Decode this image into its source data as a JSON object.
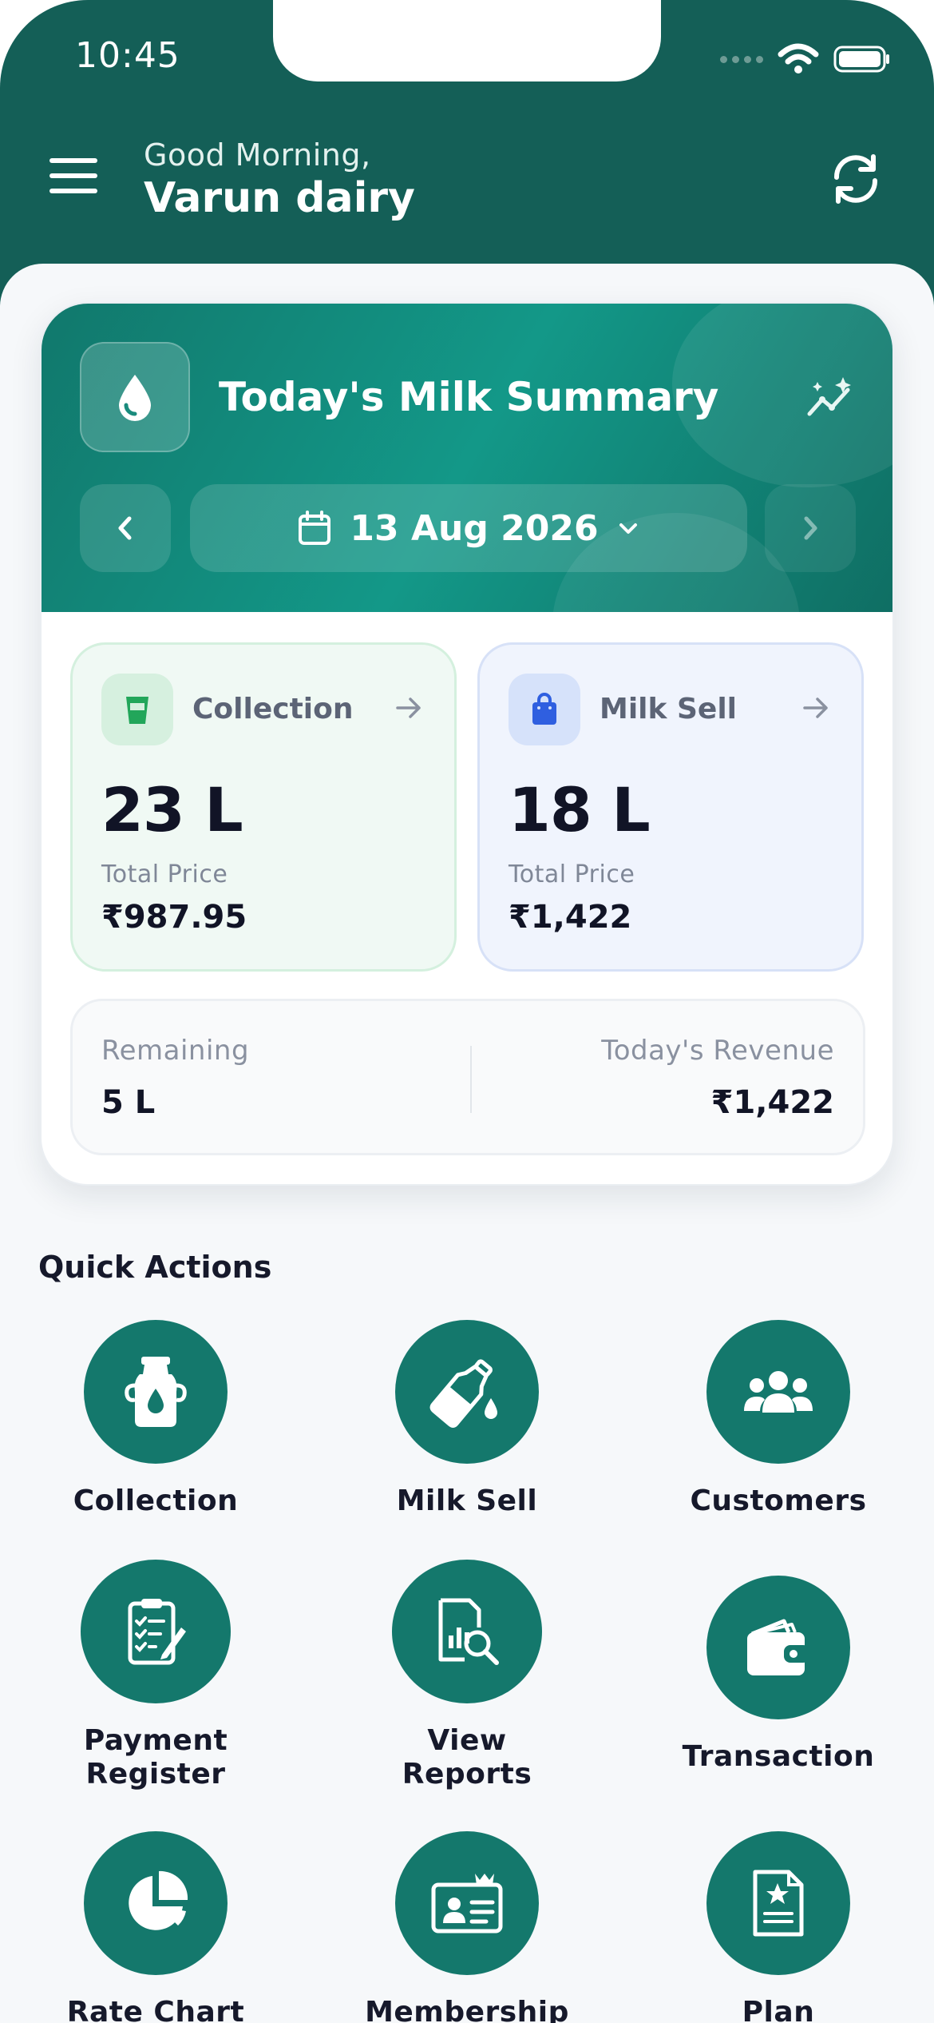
{
  "status_bar": {
    "time": "10:45"
  },
  "header": {
    "greeting": "Good Morning,",
    "business_name": "Varun dairy"
  },
  "summary": {
    "title": "Today's Milk Summary",
    "date": "13 Aug 2026",
    "collection": {
      "label": "Collection",
      "value": "23 L",
      "price_label": "Total Price",
      "price": "₹987.95"
    },
    "milk_sell": {
      "label": "Milk Sell",
      "value": "18 L",
      "price_label": "Total Price",
      "price": "₹1,422"
    },
    "remaining": {
      "label": "Remaining",
      "value": "5 L"
    },
    "revenue": {
      "label": "Today's Revenue",
      "value": "₹1,422"
    }
  },
  "quick_actions": {
    "title": "Quick Actions",
    "items": [
      {
        "label": "Collection",
        "icon": "milk-can-icon"
      },
      {
        "label": "Milk Sell",
        "icon": "milk-bottle-icon"
      },
      {
        "label": "Customers",
        "icon": "users-icon"
      },
      {
        "label": "Payment\nRegister",
        "icon": "clipboard-icon"
      },
      {
        "label": "View\nReports",
        "icon": "report-search-icon"
      },
      {
        "label": "Transaction",
        "icon": "wallet-icon"
      },
      {
        "label": "Rate Chart",
        "icon": "pie-chart-icon"
      },
      {
        "label": "Membership",
        "icon": "id-card-icon"
      },
      {
        "label": "Plan",
        "icon": "document-star-icon"
      }
    ]
  },
  "colors": {
    "primary": "#145f57",
    "accent": "#14786c",
    "collection_green": "#22a65a",
    "sell_blue": "#2f5fe0"
  }
}
